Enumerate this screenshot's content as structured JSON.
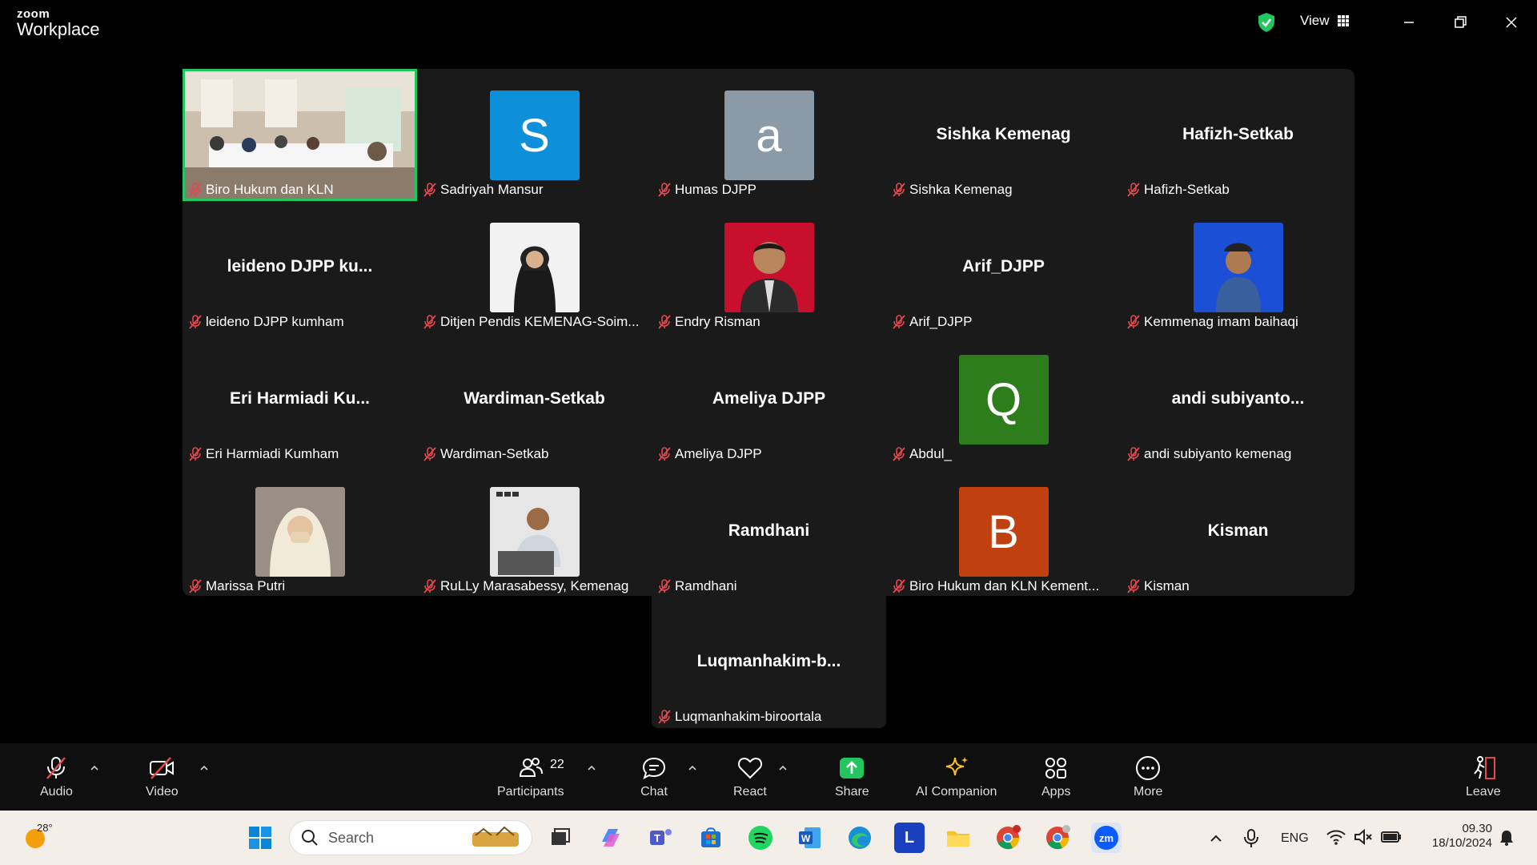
{
  "app": {
    "brand_line1": "zoom",
    "brand_line2": "Workplace"
  },
  "titlebar": {
    "view_label": "View"
  },
  "gallery": {
    "tiles": [
      {
        "display_name": "",
        "label": "Biro Hukum dan KLN",
        "kind": "video",
        "active_speaker": true
      },
      {
        "display_name": "",
        "label": "Sadriyah Mansur",
        "kind": "avatar",
        "initial": "S",
        "color": "#0e8fd9"
      },
      {
        "display_name": "",
        "label": "Humas DJPP",
        "kind": "avatar",
        "initial": "a",
        "color": "#8a9aa6"
      },
      {
        "display_name": "Sishka Kemenag",
        "label": "Sishka Kemenag",
        "kind": "name"
      },
      {
        "display_name": "Hafizh-Setkab",
        "label": "Hafizh-Setkab",
        "kind": "name"
      },
      {
        "display_name": "leideno DJPP ku...",
        "label": "leideno DJPP kumham",
        "kind": "name"
      },
      {
        "display_name": "",
        "label": "Ditjen Pendis KEMENAG-Soim...",
        "kind": "photo"
      },
      {
        "display_name": "",
        "label": "Endry Risman",
        "kind": "photo"
      },
      {
        "display_name": "Arif_DJPP",
        "label": "Arif_DJPP",
        "kind": "name"
      },
      {
        "display_name": "",
        "label": "Kemmenag imam baihaqi",
        "kind": "photo"
      },
      {
        "display_name": "Eri Harmiadi Ku...",
        "label": "Eri Harmiadi Kumham",
        "kind": "name"
      },
      {
        "display_name": "Wardiman-Setkab",
        "label": "Wardiman-Setkab",
        "kind": "name"
      },
      {
        "display_name": "Ameliya DJPP",
        "label": "Ameliya DJPP",
        "kind": "name"
      },
      {
        "display_name": "",
        "label": "Abdul_",
        "kind": "avatar",
        "initial": "Q",
        "color": "#2e7d1c"
      },
      {
        "display_name": "andi subiyanto...",
        "label": "andi subiyanto kemenag",
        "kind": "name"
      },
      {
        "display_name": "",
        "label": "Marissa Putri",
        "kind": "photo"
      },
      {
        "display_name": "",
        "label": "RuLLy Marasabessy, Kemenag",
        "kind": "photo"
      },
      {
        "display_name": "Ramdhani",
        "label": "Ramdhani",
        "kind": "name"
      },
      {
        "display_name": "",
        "label": "Biro Hukum dan KLN Kement...",
        "kind": "avatar",
        "initial": "B",
        "color": "#c0400f"
      },
      {
        "display_name": "Kisman",
        "label": "Kisman",
        "kind": "name"
      }
    ],
    "extra_tile": {
      "display_name": "Luqmanhakim-b...",
      "label": "Luqmanhakim-biroortala"
    }
  },
  "toolbar": {
    "audio": "Audio",
    "video": "Video",
    "participants": "Participants",
    "participants_count": "22",
    "chat": "Chat",
    "react": "React",
    "share": "Share",
    "ai_companion": "AI Companion",
    "apps": "Apps",
    "more": "More",
    "leave": "Leave"
  },
  "taskbar": {
    "weather_temp": "28°",
    "search_placeholder": "Search",
    "language": "ENG",
    "time": "09.30",
    "date": "18/10/2024"
  }
}
